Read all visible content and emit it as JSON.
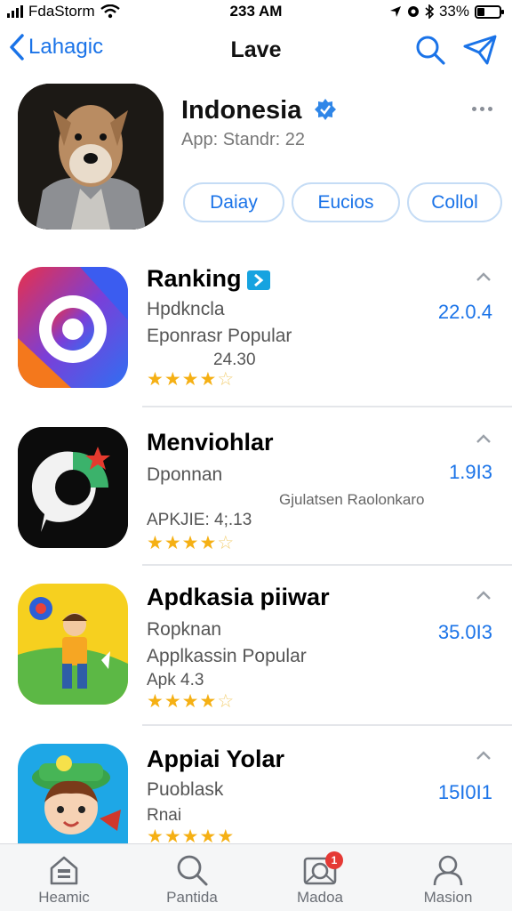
{
  "status_bar": {
    "carrier": "FdaStorm",
    "time": "233 AM",
    "battery": "33%",
    "battery_level": 0.33
  },
  "nav": {
    "back_label": "Lahagic",
    "title": "Lave"
  },
  "profile": {
    "name": "Indonesia",
    "meta": "App: Standr: 22",
    "buttons": [
      "Daiay",
      "Eucios",
      "Collol"
    ]
  },
  "apps": [
    {
      "title": "Ranking",
      "subtitle": "Hpdkncla",
      "subtitle2": "Eponrasr Popular",
      "score": "24.30",
      "version": "22.0.4",
      "rating": 4,
      "has_badge": true
    },
    {
      "title": "Menviohlar",
      "subtitle": "Dponnan",
      "extra": "Gjulatsen Raolonkaro",
      "score": "APKJIE: 4;.13",
      "version": "1.9I3",
      "rating": 4
    },
    {
      "title": "Apdkasia piiwar",
      "subtitle": "Ropknan",
      "subtitle2": "Applkassin Popular",
      "score": "Apk 4.3",
      "version": "35.0I3",
      "rating": 4
    },
    {
      "title": "Appiai Yolar",
      "subtitle": "Puoblask",
      "subtitle2": "Rnai",
      "version": "15I0I1",
      "rating": 4.5
    }
  ],
  "tabs": [
    {
      "label": "Heamic",
      "icon": "home-icon"
    },
    {
      "label": "Pantida",
      "icon": "search-icon"
    },
    {
      "label": "Madoa",
      "icon": "media-icon",
      "badge": "1"
    },
    {
      "label": "Masion",
      "icon": "profile-icon"
    }
  ],
  "colors": {
    "accent": "#1a73e8",
    "star": "#f5b014",
    "badge": "#e53935"
  }
}
